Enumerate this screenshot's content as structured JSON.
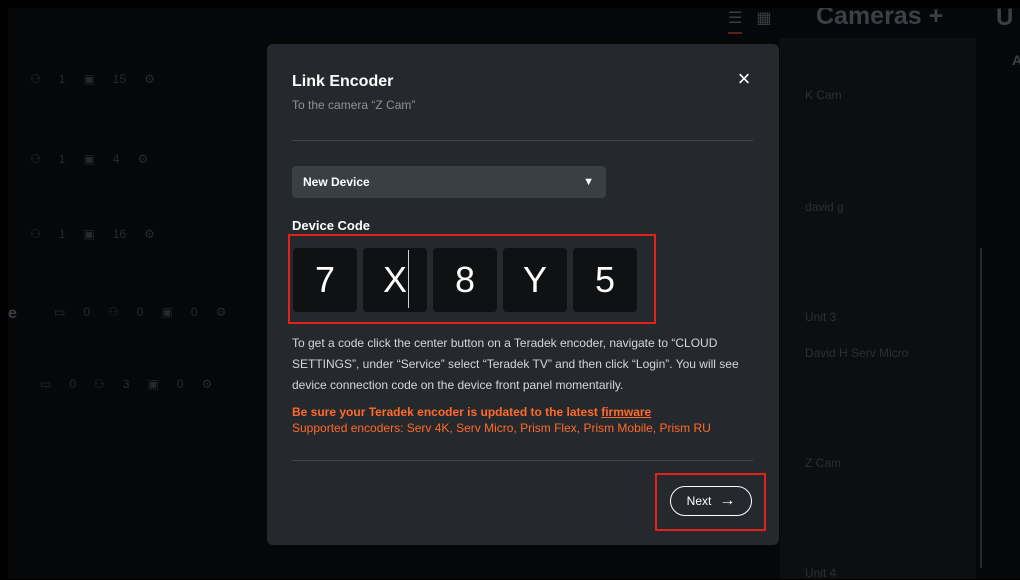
{
  "background": {
    "rows": [
      [
        "1",
        "15"
      ],
      [
        "1",
        "4"
      ],
      [
        "1",
        "16"
      ],
      [
        "0",
        "0",
        "0"
      ],
      [
        "0",
        "3",
        "0"
      ]
    ],
    "left_letter": "e",
    "cameras_title": "Cameras +",
    "right_letter_u": "U",
    "right_letter_a": "A",
    "panel_items": [
      "K Cam",
      "david g",
      "Unit 3",
      "David H Serv Micro",
      "Z Cam",
      "Unit 4"
    ]
  },
  "modal": {
    "title": "Link Encoder",
    "subtitle": "To the camera “Z Cam”",
    "close_icon": "×",
    "select": {
      "value": "New Device",
      "chevron": "⌄"
    },
    "code_label": "Device Code",
    "digits": [
      "7",
      "X",
      "8",
      "Y",
      "5"
    ],
    "help_text": "To get a code click the center button on a Teradek encoder, navigate to “CLOUD SETTINGS”, under “Service” select “Teradek TV” and then click “Login”. You will see device connection code on the device front panel momentarily.",
    "warning_prefix": "Be sure your Teradek encoder is updated to the latest ",
    "warning_link": "firmware",
    "supported": "Supported encoders: Serv 4K, Serv Micro, Prism Flex, Prism Mobile, Prism RU",
    "next_label": "Next",
    "next_arrow": "→"
  },
  "colors": {
    "modal_bg": "#25292d",
    "highlight": "#e0231a",
    "warning": "#ff6a2b"
  }
}
